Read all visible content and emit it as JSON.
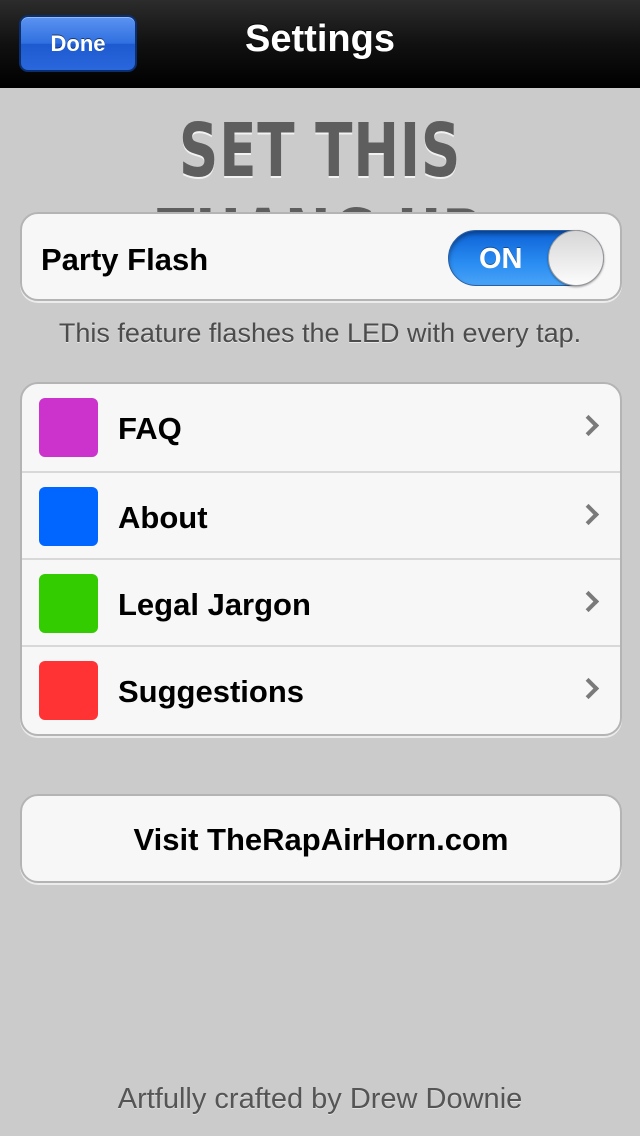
{
  "navbar": {
    "done_label": "Done",
    "title": "Settings"
  },
  "headline": "SET THIS THANG UP",
  "party_flash": {
    "label": "Party Flash",
    "toggle_text": "ON",
    "enabled": true,
    "note": "This feature flashes the LED with every tap."
  },
  "menu": {
    "items": [
      {
        "label": "FAQ",
        "color": "#cc33cc",
        "icon": "chevron-right-icon"
      },
      {
        "label": "About",
        "color": "#0066ff",
        "icon": "chevron-right-icon"
      },
      {
        "label": "Legal Jargon",
        "color": "#33cc00",
        "icon": "chevron-right-icon"
      },
      {
        "label": "Suggestions",
        "color": "#ff3333",
        "icon": "chevron-right-icon"
      }
    ]
  },
  "visit": {
    "label": "Visit TheRapAirHorn.com"
  },
  "footer": "Artfully crafted by Drew Downie",
  "colors": {
    "background": "#cbcbcb",
    "toggle_on": "#2a8df2",
    "done_button": "#2f6fe0"
  }
}
